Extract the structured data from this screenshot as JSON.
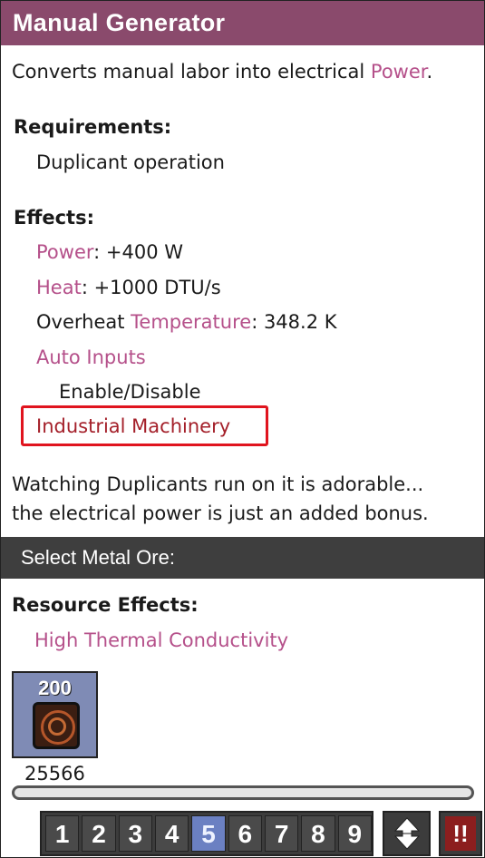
{
  "title": "Manual Generator",
  "description": {
    "prefix": "Converts manual labor into electrical ",
    "link": "Power",
    "suffix": "."
  },
  "requirements": {
    "heading": "Requirements:",
    "items": [
      "Duplicant operation"
    ]
  },
  "effects": {
    "heading": "Effects:",
    "power": {
      "label": "Power",
      "value": ": +400 W"
    },
    "heat": {
      "label": "Heat",
      "value": ": +1000 DTU/s"
    },
    "overheat": {
      "prefix": "Overheat ",
      "label": "Temperature",
      "value": ": 348.2 K"
    },
    "auto_inputs": {
      "label": "Auto Inputs",
      "sub": "Enable/Disable"
    },
    "category": "Industrial Machinery"
  },
  "flavor": {
    "line1": "Watching Duplicants run on it is adorable...",
    "line2": "the electrical power is just an added bonus."
  },
  "material_section": {
    "title": "Select Metal Ore:"
  },
  "resource_effects": {
    "heading": "Resource Effects:",
    "items": [
      "High Thermal Conductivity"
    ]
  },
  "ore_tile": {
    "count": "200",
    "quantity": "25566",
    "icon": "metal-ore-icon"
  },
  "toolbar": {
    "numbers": [
      "1",
      "2",
      "3",
      "4",
      "5",
      "6",
      "7",
      "8",
      "9"
    ],
    "active_index": 4,
    "sort_icon": "sort-arrows-icon",
    "alert_label": "!!"
  },
  "colors": {
    "title_bar": "#8a4a6c",
    "link": "#b5508a",
    "highlight_box": "#e0141e",
    "category_text": "#a4202a",
    "active_number": "#6b80c2"
  }
}
